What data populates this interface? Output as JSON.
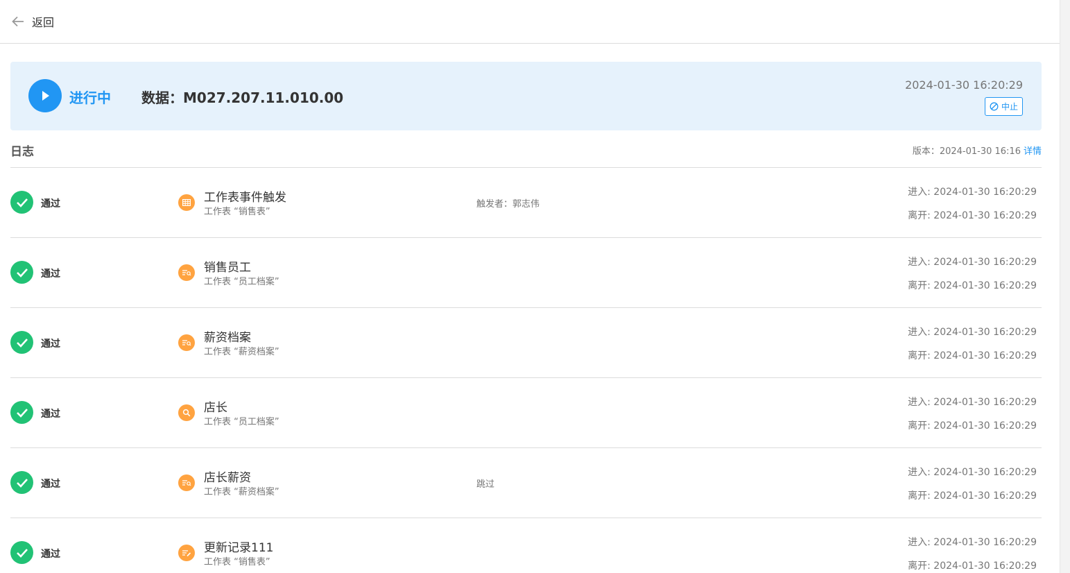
{
  "header": {
    "back_label": "返回"
  },
  "status": {
    "state": "进行中",
    "data_label": "数据：M027.207.11.010.00",
    "time": "2024-01-30 16:20:29",
    "abort_label": "中止"
  },
  "log": {
    "title": "日志",
    "version_text": "版本：2024-01-30 16:16",
    "details_label": "详情",
    "rows": [
      {
        "status": "通过",
        "icon": "table-icon",
        "name": "工作表事件触发",
        "sub": "工作表 “销售表”",
        "extra": "触发者：郭志伟",
        "enter": "进入: 2024-01-30 16:20:29",
        "leave": "离开: 2024-01-30 16:20:29"
      },
      {
        "status": "通过",
        "icon": "get-records-icon",
        "name": "销售员工",
        "sub": "工作表 “员工档案”",
        "extra": "",
        "enter": "进入: 2024-01-30 16:20:29",
        "leave": "离开: 2024-01-30 16:20:29"
      },
      {
        "status": "通过",
        "icon": "get-records-icon",
        "name": "薪资档案",
        "sub": "工作表 “薪资档案”",
        "extra": "",
        "enter": "进入: 2024-01-30 16:20:29",
        "leave": "离开: 2024-01-30 16:20:29"
      },
      {
        "status": "通过",
        "icon": "search-icon",
        "name": "店长",
        "sub": "工作表 “员工档案”",
        "extra": "",
        "enter": "进入: 2024-01-30 16:20:29",
        "leave": "离开: 2024-01-30 16:20:29"
      },
      {
        "status": "通过",
        "icon": "get-records-icon",
        "name": "店长薪资",
        "sub": "工作表 “薪资档案”",
        "extra": "跳过",
        "enter": "进入: 2024-01-30 16:20:29",
        "leave": "离开: 2024-01-30 16:20:29"
      },
      {
        "status": "通过",
        "icon": "edit-record-icon",
        "name": "更新记录111",
        "sub": "工作表 “销售表”",
        "extra": "",
        "enter": "进入: 2024-01-30 16:20:29",
        "leave": "离开: 2024-01-30 16:20:29"
      }
    ]
  },
  "colors": {
    "accent": "#2196f3",
    "success": "#21c275",
    "node": "#ffa340",
    "card_bg": "#e6f2fc"
  }
}
